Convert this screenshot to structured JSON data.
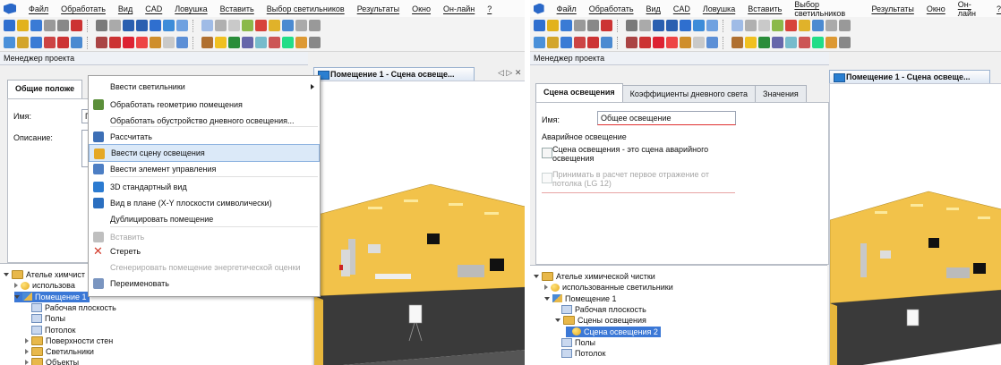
{
  "menubar": [
    "Файл",
    "Обработать",
    "Вид",
    "CAD",
    "Ловушка",
    "Вставить",
    "Выбор светильников",
    "Результаты",
    "Окно",
    "Он-лайн",
    "?"
  ],
  "colors": {
    "accent": "#2a68c8",
    "highlight": "#dbe9f8",
    "floor": "#3a3a3a",
    "wall": "#f2c24a",
    "error_underline": "#e03030"
  },
  "left": {
    "pm_title": "Менеджер проекта",
    "tab_general": "Общие положе",
    "name_label": "Имя:",
    "name_value": "П",
    "desc_label": "Описание:",
    "doc_tab": "Помещение 1 - Сцена освеще...",
    "nav_arrows": "◁ ▷ ✕",
    "tree": [
      {
        "label": "Ателье химчист",
        "icon": "folder",
        "indent": 0,
        "open": true
      },
      {
        "label": "использова",
        "icon": "luminaires",
        "indent": 1,
        "open": false
      },
      {
        "label": "Помещение 1",
        "icon": "room",
        "indent": 1,
        "open": true,
        "selected": true
      },
      {
        "label": "Рабочая плоскость",
        "icon": "sheet",
        "indent": 2
      },
      {
        "label": "Полы",
        "icon": "sheet",
        "indent": 2
      },
      {
        "label": "Потолок",
        "icon": "sheet",
        "indent": 2
      },
      {
        "label": "Поверхности стен",
        "icon": "folder",
        "indent": 2,
        "open": false
      },
      {
        "label": "Светильники",
        "icon": "folder",
        "indent": 2,
        "open": false
      },
      {
        "label": "Объекты",
        "icon": "folder",
        "indent": 2,
        "open": false
      }
    ],
    "context_menu": [
      {
        "label": "Ввести светильники",
        "icon": "",
        "submenu": true
      },
      {
        "label": "Обработать геометрию помещения",
        "icon": "geometry-icon"
      },
      {
        "label": "Обработать обустройство дневного освещения...",
        "icon": ""
      },
      {
        "label": "Рассчитать",
        "icon": "calculator-icon"
      },
      {
        "label": "Ввести сцену освещения",
        "icon": "light-scene-icon",
        "highlight": true
      },
      {
        "label": "Ввести элемент управления",
        "icon": "control-element-icon"
      },
      {
        "label": "3D стандартный вид",
        "icon": "cube-icon"
      },
      {
        "label": "Вид в плане (X-Y плоскости символически)",
        "icon": "plan-view-icon"
      },
      {
        "label": "Дублицировать помещение",
        "icon": ""
      },
      {
        "label": "Вставить",
        "icon": "paste-icon",
        "disabled": true
      },
      {
        "label": "Стереть",
        "icon": "delete-icon"
      },
      {
        "label": "Сгенерировать помещение энергетической оценки",
        "icon": "",
        "disabled": true
      },
      {
        "label": "Переименовать",
        "icon": "rename-icon"
      }
    ]
  },
  "right": {
    "pm_title": "Менеджер проекта",
    "tabs": [
      "Сцена освещения",
      "Коэффициенты дневного света",
      "Значения"
    ],
    "name_label": "Имя:",
    "name_value": "Общее освещение",
    "emergency_heading": "Аварийное освещение",
    "checkbox1": "Сцена освещения - это сцена аварийного освещения",
    "checkbox2": "Принимать в расчет первое отражение от потолка (LG 12)",
    "doc_tab": "Помещение 1 - Сцена освеще...",
    "tree": [
      {
        "label": "Ателье химической чистки",
        "icon": "folder",
        "indent": 0,
        "open": true
      },
      {
        "label": "использованные светильники",
        "icon": "luminaires",
        "indent": 1,
        "open": false
      },
      {
        "label": "Помещение 1",
        "icon": "room",
        "indent": 1,
        "open": true
      },
      {
        "label": "Рабочая плоскость",
        "icon": "sheet",
        "indent": 2
      },
      {
        "label": "Сцены освещения",
        "icon": "folder",
        "indent": 2,
        "open": true
      },
      {
        "label": "Сцена освещения 2",
        "icon": "bulb",
        "indent": 3,
        "selected": true
      },
      {
        "label": "Полы",
        "icon": "sheet",
        "indent": 2
      },
      {
        "label": "Потолок",
        "icon": "sheet",
        "indent": 2
      }
    ]
  }
}
